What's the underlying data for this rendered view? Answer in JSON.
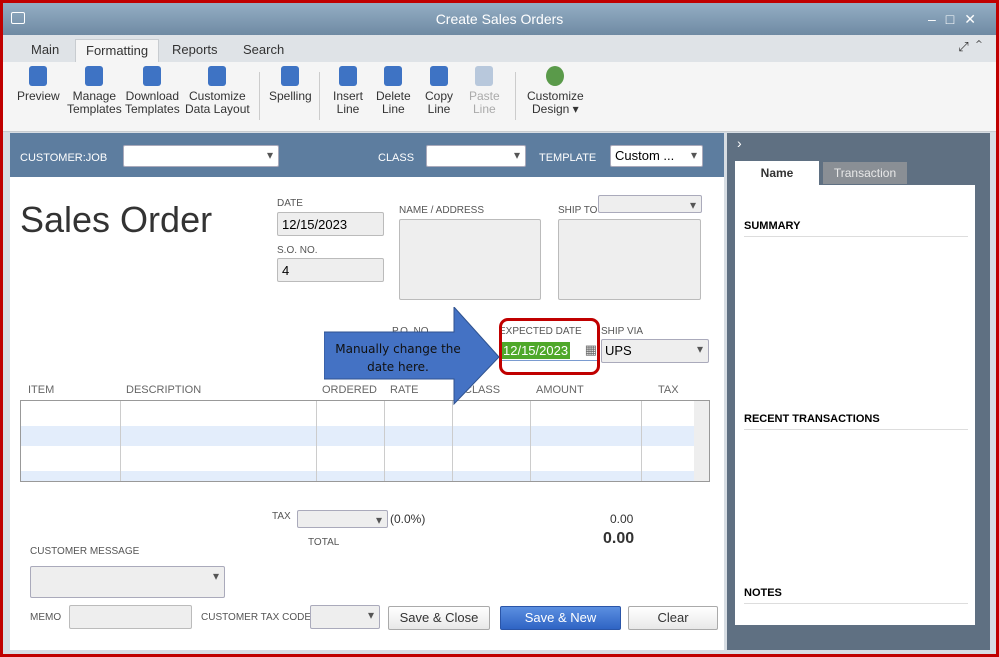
{
  "window": {
    "title": "Create Sales Orders"
  },
  "tabs": [
    "Main",
    "Formatting",
    "Reports",
    "Search"
  ],
  "toolbar": [
    {
      "l1": "Preview",
      "l2": ""
    },
    {
      "l1": "Manage",
      "l2": "Templates"
    },
    {
      "l1": "Download",
      "l2": "Templates"
    },
    {
      "l1": "Customize",
      "l2": "Data Layout"
    },
    {
      "l1": "Spelling",
      "l2": ""
    },
    {
      "l1": "Insert",
      "l2": "Line"
    },
    {
      "l1": "Delete",
      "l2": "Line"
    },
    {
      "l1": "Copy",
      "l2": "Line"
    },
    {
      "l1": "Paste",
      "l2": "Line"
    },
    {
      "l1": "Customize",
      "l2": "Design ▾"
    }
  ],
  "header": {
    "customer_job": "CUSTOMER:JOB",
    "class": "CLASS",
    "template": "TEMPLATE",
    "template_value": "Custom ..."
  },
  "form": {
    "title": "Sales Order",
    "date_label": "DATE",
    "date": "12/15/2023",
    "so_label": "S.O. NO.",
    "so": "4",
    "name_address": "NAME / ADDRESS",
    "ship_to": "SHIP TO",
    "po_label": "P.O. NO.",
    "expected_label": "EXPECTED DATE",
    "expected": "12/15/2023",
    "ship_via_label": "SHIP VIA",
    "ship_via": "UPS"
  },
  "callout": "Manually change the date here.",
  "columns": [
    "ITEM",
    "DESCRIPTION",
    "ORDERED",
    "RATE",
    "CLASS",
    "AMOUNT",
    "TAX"
  ],
  "footer": {
    "tax": "TAX",
    "tax_pct": "(0.0%)",
    "tax_amt": "0.00",
    "total": "TOTAL",
    "total_amt": "0.00",
    "cust_msg": "CUSTOMER MESSAGE",
    "memo": "MEMO",
    "cust_tax": "CUSTOMER TAX CODE",
    "save_close": "Save & Close",
    "save_new": "Save & New",
    "clear": "Clear"
  },
  "panel": {
    "tab_name": "Name",
    "tab_transaction": "Transaction",
    "summary": "SUMMARY",
    "recent": "RECENT TRANSACTIONS",
    "notes": "NOTES"
  }
}
